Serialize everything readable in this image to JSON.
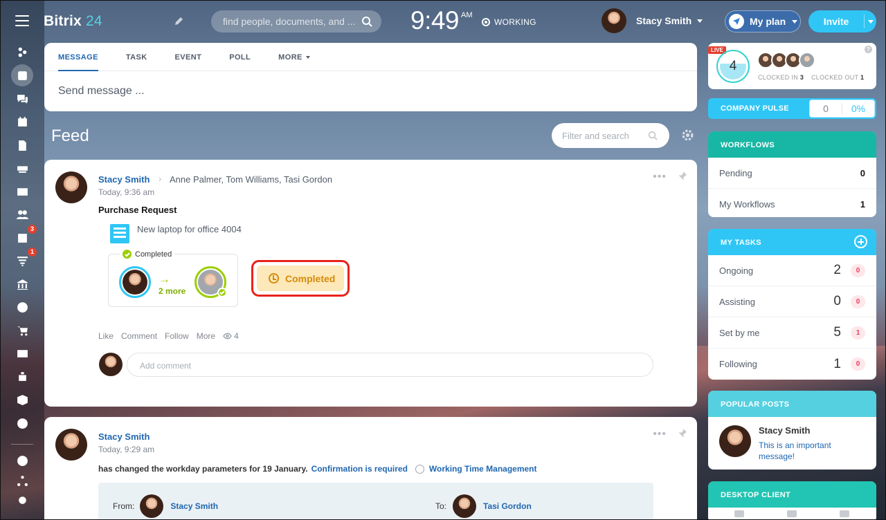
{
  "header": {
    "logo_main": "Bitrix",
    "logo_num": "24",
    "search_placeholder": "find people, documents, and ...",
    "clock": "9:49",
    "ampm": "AM",
    "work_status": "WORKING",
    "user_name": "Stacy Smith",
    "my_plan": "My plan",
    "invite": "Invite"
  },
  "sidebar": {
    "badges": {
      "tasks": "3",
      "funnel": "1"
    }
  },
  "composer": {
    "tabs": [
      "MESSAGE",
      "TASK",
      "EVENT",
      "POLL",
      "MORE"
    ],
    "placeholder": "Send message ..."
  },
  "feed": {
    "title": "Feed",
    "filter_placeholder": "Filter and search"
  },
  "post1": {
    "author": "Stacy Smith",
    "recipients": "Anne Palmer, Tom Williams, Tasi Gordon",
    "time": "Today, 9:36 am",
    "heading": "Purchase Request",
    "document": "New laptop for office 4004",
    "flow_label": "Completed",
    "flow_more": "2 more",
    "status": "Completed",
    "actions": [
      "Like",
      "Comment",
      "Follow",
      "More"
    ],
    "views": "4",
    "comment_placeholder": "Add comment"
  },
  "post2": {
    "author": "Stacy Smith",
    "time": "Today, 9:29 am",
    "text": "has changed the workday parameters for 19 January.",
    "confirm_link": "Confirmation is required",
    "module_link": "Working Time Management",
    "from_label": "From:",
    "from_name": "Stacy Smith",
    "to_label": "To:",
    "to_name": "Tasi Gordon"
  },
  "right": {
    "live_tag": "LIVE",
    "live_count": "4",
    "clocked_in_label": "CLOCKED IN",
    "clocked_in": "3",
    "clocked_out_label": "CLOCKED OUT",
    "clocked_out": "1",
    "pulse_title": "COMPANY PULSE",
    "pulse_value": "0",
    "pulse_percent": "0%",
    "workflows_title": "WORKFLOWS",
    "workflows": [
      {
        "label": "Pending",
        "value": "0"
      },
      {
        "label": "My Workflows",
        "value": "1"
      }
    ],
    "tasks_title": "MY TASKS",
    "tasks": [
      {
        "label": "Ongoing",
        "value": "2",
        "count": "0"
      },
      {
        "label": "Assisting",
        "value": "0",
        "count": "0"
      },
      {
        "label": "Set by me",
        "value": "5",
        "count": "1"
      },
      {
        "label": "Following",
        "value": "1",
        "count": "0"
      }
    ],
    "popular_title": "POPULAR POSTS",
    "popular_author": "Stacy Smith",
    "popular_text": "This is an important message!",
    "desktop_title": "DESKTOP CLIENT"
  }
}
